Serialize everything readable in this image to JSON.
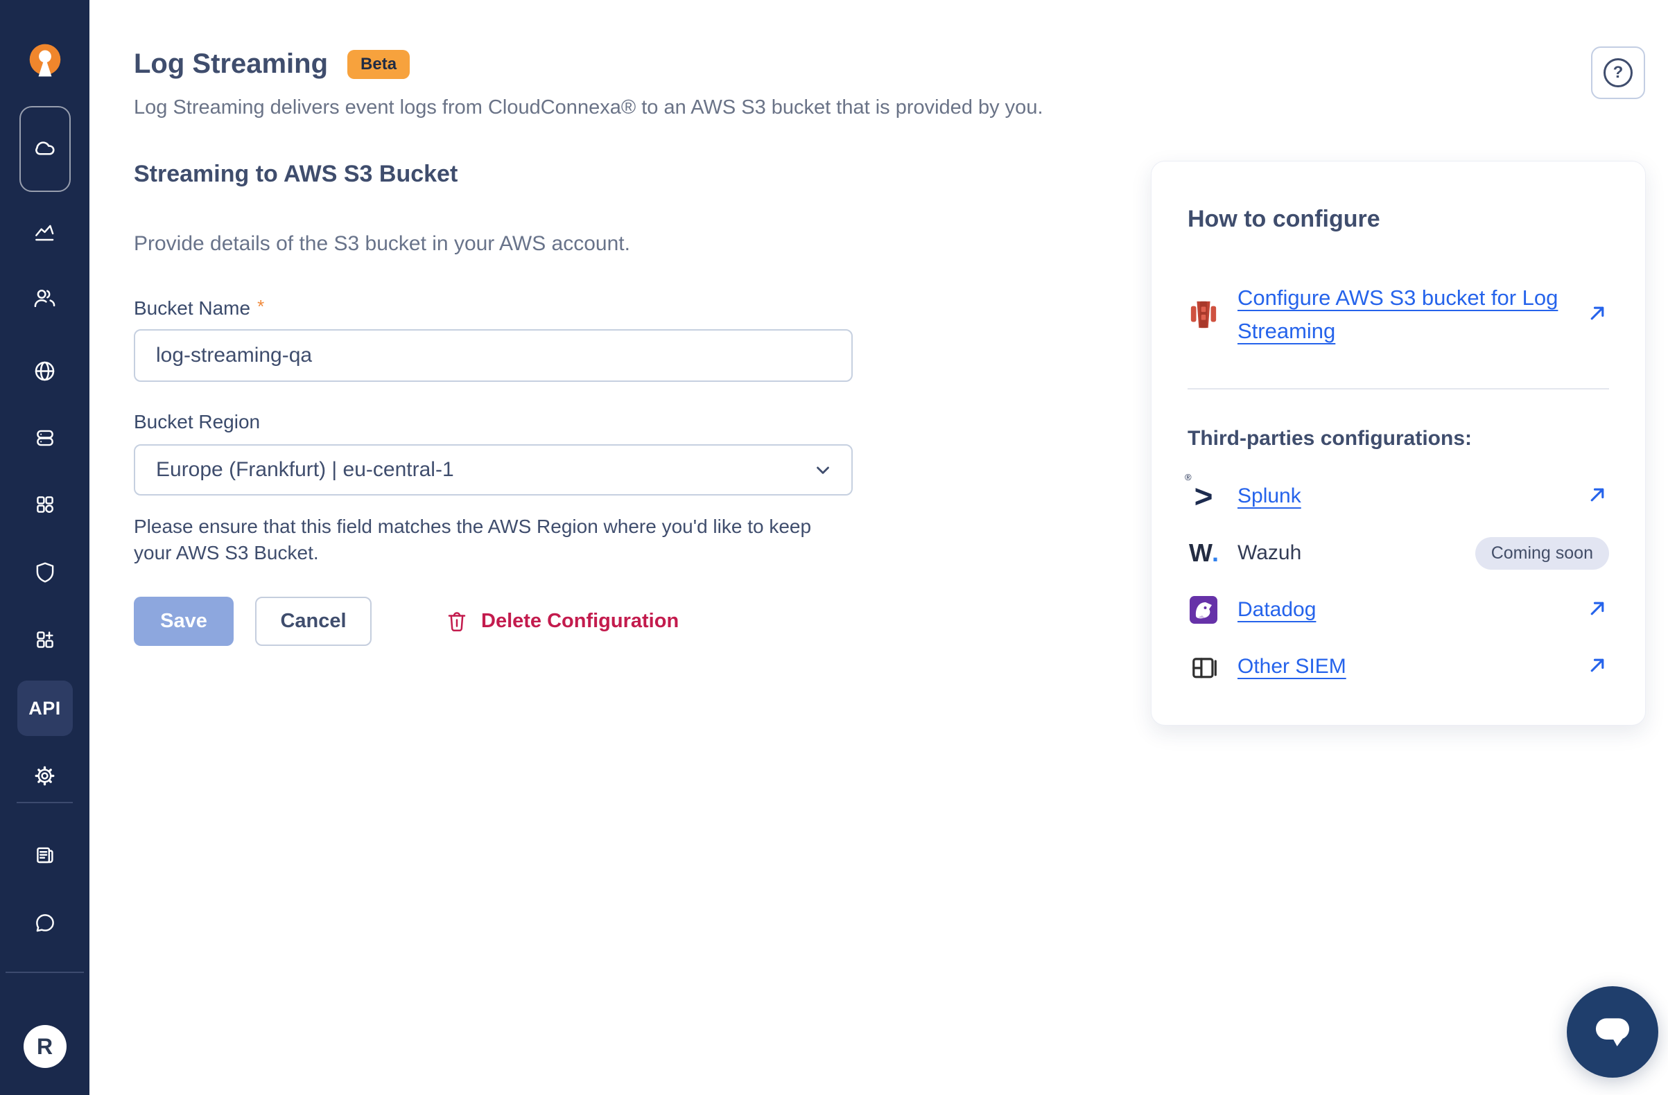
{
  "header": {
    "title": "Log Streaming",
    "badge": "Beta",
    "description": "Log Streaming delivers event logs from CloudConnexa® to an AWS S3 bucket that is provided by you."
  },
  "sidebar": {
    "api_label": "API",
    "avatar_initial": "R"
  },
  "form": {
    "section_title": "Streaming to AWS S3 Bucket",
    "section_description": "Provide details of the S3 bucket in your AWS account.",
    "bucket_name": {
      "label": "Bucket Name",
      "required_mark": "*",
      "value": "log-streaming-qa"
    },
    "bucket_region": {
      "label": "Bucket Region",
      "value": "Europe (Frankfurt) | eu-central-1",
      "helper": "Please ensure that this field matches the AWS Region where you'd like to keep your AWS S3 Bucket."
    },
    "save_label": "Save",
    "cancel_label": "Cancel",
    "delete_label": "Delete Configuration"
  },
  "howto": {
    "title": "How to configure",
    "primary_link": {
      "text": "Configure AWS S3 bucket for Log Streaming"
    },
    "third_party_heading": "Third-parties configurations:",
    "items": [
      {
        "name": "Splunk",
        "icon_glyph": ">",
        "registered_mark": "®",
        "link": true
      },
      {
        "name": "Wazuh",
        "icon_letter": "W",
        "icon_dot": ".",
        "badge": "Coming soon",
        "link": false
      },
      {
        "name": "Datadog",
        "link": true
      },
      {
        "name": "Other SIEM",
        "link": true
      }
    ]
  },
  "icons": {
    "help_glyph": "?"
  },
  "colors": {
    "sidebar_bg": "#1a294c",
    "brand_orange": "#f0862c",
    "beta_bg": "#f7a23d",
    "link_blue": "#2563eb",
    "delete_red": "#c31b4d",
    "save_disabled_bg": "#8da7de",
    "coming_soon_bg": "#e2e5f2",
    "heading_navy": "#3f4d6d"
  }
}
